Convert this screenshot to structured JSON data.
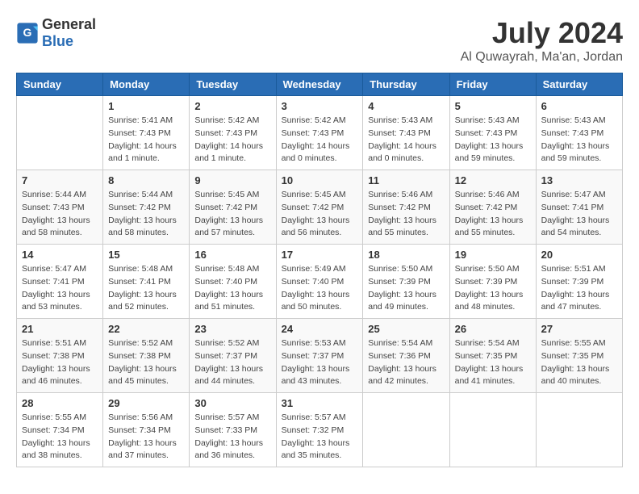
{
  "header": {
    "logo_general": "General",
    "logo_blue": "Blue",
    "month_title": "July 2024",
    "location": "Al Quwayrah, Ma'an, Jordan"
  },
  "calendar": {
    "days_of_week": [
      "Sunday",
      "Monday",
      "Tuesday",
      "Wednesday",
      "Thursday",
      "Friday",
      "Saturday"
    ],
    "weeks": [
      [
        {
          "day": "",
          "info": ""
        },
        {
          "day": "1",
          "info": "Sunrise: 5:41 AM\nSunset: 7:43 PM\nDaylight: 14 hours\nand 1 minute."
        },
        {
          "day": "2",
          "info": "Sunrise: 5:42 AM\nSunset: 7:43 PM\nDaylight: 14 hours\nand 1 minute."
        },
        {
          "day": "3",
          "info": "Sunrise: 5:42 AM\nSunset: 7:43 PM\nDaylight: 14 hours\nand 0 minutes."
        },
        {
          "day": "4",
          "info": "Sunrise: 5:43 AM\nSunset: 7:43 PM\nDaylight: 14 hours\nand 0 minutes."
        },
        {
          "day": "5",
          "info": "Sunrise: 5:43 AM\nSunset: 7:43 PM\nDaylight: 13 hours\nand 59 minutes."
        },
        {
          "day": "6",
          "info": "Sunrise: 5:43 AM\nSunset: 7:43 PM\nDaylight: 13 hours\nand 59 minutes."
        }
      ],
      [
        {
          "day": "7",
          "info": "Sunrise: 5:44 AM\nSunset: 7:43 PM\nDaylight: 13 hours\nand 58 minutes."
        },
        {
          "day": "8",
          "info": "Sunrise: 5:44 AM\nSunset: 7:42 PM\nDaylight: 13 hours\nand 58 minutes."
        },
        {
          "day": "9",
          "info": "Sunrise: 5:45 AM\nSunset: 7:42 PM\nDaylight: 13 hours\nand 57 minutes."
        },
        {
          "day": "10",
          "info": "Sunrise: 5:45 AM\nSunset: 7:42 PM\nDaylight: 13 hours\nand 56 minutes."
        },
        {
          "day": "11",
          "info": "Sunrise: 5:46 AM\nSunset: 7:42 PM\nDaylight: 13 hours\nand 55 minutes."
        },
        {
          "day": "12",
          "info": "Sunrise: 5:46 AM\nSunset: 7:42 PM\nDaylight: 13 hours\nand 55 minutes."
        },
        {
          "day": "13",
          "info": "Sunrise: 5:47 AM\nSunset: 7:41 PM\nDaylight: 13 hours\nand 54 minutes."
        }
      ],
      [
        {
          "day": "14",
          "info": "Sunrise: 5:47 AM\nSunset: 7:41 PM\nDaylight: 13 hours\nand 53 minutes."
        },
        {
          "day": "15",
          "info": "Sunrise: 5:48 AM\nSunset: 7:41 PM\nDaylight: 13 hours\nand 52 minutes."
        },
        {
          "day": "16",
          "info": "Sunrise: 5:48 AM\nSunset: 7:40 PM\nDaylight: 13 hours\nand 51 minutes."
        },
        {
          "day": "17",
          "info": "Sunrise: 5:49 AM\nSunset: 7:40 PM\nDaylight: 13 hours\nand 50 minutes."
        },
        {
          "day": "18",
          "info": "Sunrise: 5:50 AM\nSunset: 7:39 PM\nDaylight: 13 hours\nand 49 minutes."
        },
        {
          "day": "19",
          "info": "Sunrise: 5:50 AM\nSunset: 7:39 PM\nDaylight: 13 hours\nand 48 minutes."
        },
        {
          "day": "20",
          "info": "Sunrise: 5:51 AM\nSunset: 7:39 PM\nDaylight: 13 hours\nand 47 minutes."
        }
      ],
      [
        {
          "day": "21",
          "info": "Sunrise: 5:51 AM\nSunset: 7:38 PM\nDaylight: 13 hours\nand 46 minutes."
        },
        {
          "day": "22",
          "info": "Sunrise: 5:52 AM\nSunset: 7:38 PM\nDaylight: 13 hours\nand 45 minutes."
        },
        {
          "day": "23",
          "info": "Sunrise: 5:52 AM\nSunset: 7:37 PM\nDaylight: 13 hours\nand 44 minutes."
        },
        {
          "day": "24",
          "info": "Sunrise: 5:53 AM\nSunset: 7:37 PM\nDaylight: 13 hours\nand 43 minutes."
        },
        {
          "day": "25",
          "info": "Sunrise: 5:54 AM\nSunset: 7:36 PM\nDaylight: 13 hours\nand 42 minutes."
        },
        {
          "day": "26",
          "info": "Sunrise: 5:54 AM\nSunset: 7:35 PM\nDaylight: 13 hours\nand 41 minutes."
        },
        {
          "day": "27",
          "info": "Sunrise: 5:55 AM\nSunset: 7:35 PM\nDaylight: 13 hours\nand 40 minutes."
        }
      ],
      [
        {
          "day": "28",
          "info": "Sunrise: 5:55 AM\nSunset: 7:34 PM\nDaylight: 13 hours\nand 38 minutes."
        },
        {
          "day": "29",
          "info": "Sunrise: 5:56 AM\nSunset: 7:34 PM\nDaylight: 13 hours\nand 37 minutes."
        },
        {
          "day": "30",
          "info": "Sunrise: 5:57 AM\nSunset: 7:33 PM\nDaylight: 13 hours\nand 36 minutes."
        },
        {
          "day": "31",
          "info": "Sunrise: 5:57 AM\nSunset: 7:32 PM\nDaylight: 13 hours\nand 35 minutes."
        },
        {
          "day": "",
          "info": ""
        },
        {
          "day": "",
          "info": ""
        },
        {
          "day": "",
          "info": ""
        }
      ]
    ]
  }
}
